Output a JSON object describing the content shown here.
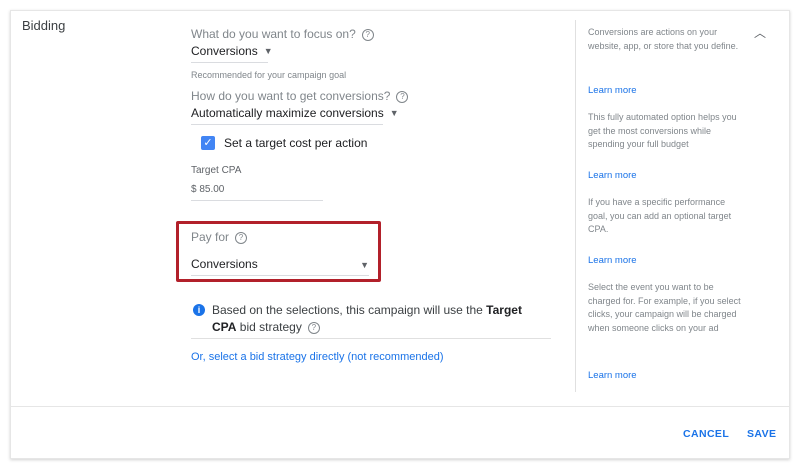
{
  "section": {
    "title": "Bidding"
  },
  "focus": {
    "question": "What do you want to focus on?",
    "value": "Conversions",
    "recommendation": "Recommended for your campaign goal"
  },
  "conversions_method": {
    "question": "How do you want to get conversions?",
    "value": "Automatically maximize conversions"
  },
  "target_cpa_checkbox": {
    "label": "Set a target cost per action",
    "checked": true
  },
  "target_cpa": {
    "label": "Target CPA",
    "value": "$ 85.00"
  },
  "pay_for": {
    "label": "Pay for",
    "value": "Conversions"
  },
  "info": {
    "prefix": "Based on the selections, this campaign will use the ",
    "strategy": "Target CPA",
    "suffix": " bid strategy"
  },
  "select_strategy_link": "Or, select a bid strategy directly (not recommended)",
  "sidebar": {
    "blocks": [
      {
        "text": "Conversions are actions on your website, app, or store that you define.",
        "link": "Learn more"
      },
      {
        "text": "This fully automated option helps you get the most conversions while spending your full budget",
        "link": "Learn more"
      },
      {
        "text": "If you have a specific performance goal, you can add an optional target CPA.",
        "link": "Learn more"
      },
      {
        "text": "Select the event you want to be charged for. For example, if you select clicks, your campaign will be charged when someone clicks on your ad",
        "link": "Learn more"
      }
    ]
  },
  "footer": {
    "cancel_label": "CANCEL",
    "save_label": "SAVE"
  },
  "icons": {
    "help": "question-circle-icon",
    "info": "info-circle-icon",
    "collapse": "chevron-up-icon",
    "caret": "caret-down-icon",
    "check": "checkmark-icon"
  },
  "colors": {
    "accent": "#1a73e8",
    "checkbox": "#4285f4",
    "highlight": "#b2202a"
  }
}
